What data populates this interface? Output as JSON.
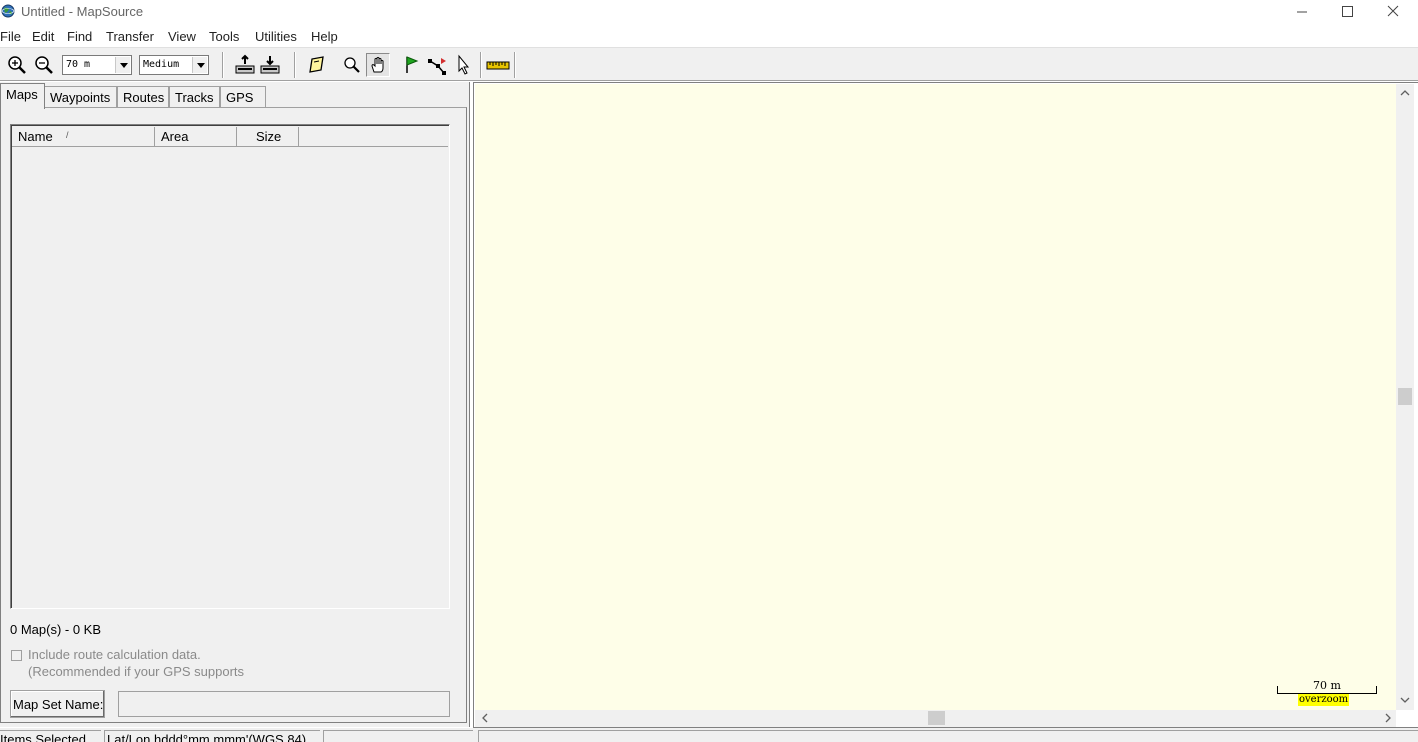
{
  "window": {
    "title": "Untitled - MapSource",
    "app_icon": "globe-icon",
    "controls": [
      "minimize-icon",
      "maximize-icon",
      "close-icon"
    ]
  },
  "menu": {
    "file": "File",
    "edit": "Edit",
    "find": "Find",
    "transfer": "Transfer",
    "view": "View",
    "tools": "Tools",
    "utilities": "Utilities",
    "help": "Help"
  },
  "toolbar": {
    "zoom_scale": "70 m",
    "detail_level": "Medium",
    "icons": [
      "zoom-in-icon",
      "zoom-out-icon",
      "receive-from-device-icon",
      "send-to-device-icon",
      "map-tool-icon",
      "zoom-tool-icon",
      "hand-tool-icon",
      "waypoint-flag-icon",
      "route-tool-icon",
      "selection-arrow-icon",
      "measure-ruler-icon"
    ],
    "active_tool": "hand-tool-icon"
  },
  "tabs": [
    "Maps",
    "Waypoints",
    "Routes",
    "Tracks",
    "GPS"
  ],
  "active_tab": "Maps",
  "maps_panel": {
    "columns": [
      "Name",
      "Area",
      "Size"
    ],
    "sort_indicator": "/",
    "rows": [],
    "summary": "0 Map(s) - 0 KB",
    "route_checkbox_label": "Include route calculation data.",
    "route_checkbox_note": "(Recommended if your GPS supports",
    "route_checkbox_checked": false,
    "mapset_button": "Map Set Name:",
    "mapset_value": ""
  },
  "map_view": {
    "background_color": "#fefee8",
    "scale_label": "70 m",
    "overzoom_label": "overzoom",
    "overzoom_color": "#ffff00",
    "vertical_scroll_position": 0.5,
    "horizontal_scroll_position": 0.5
  },
  "status_bar": {
    "selection": "Items Selected",
    "coordinate_format": "Lat/Lon hddd°mm.mmm'(WGS 84)",
    "pane3": "",
    "pane4": ""
  }
}
